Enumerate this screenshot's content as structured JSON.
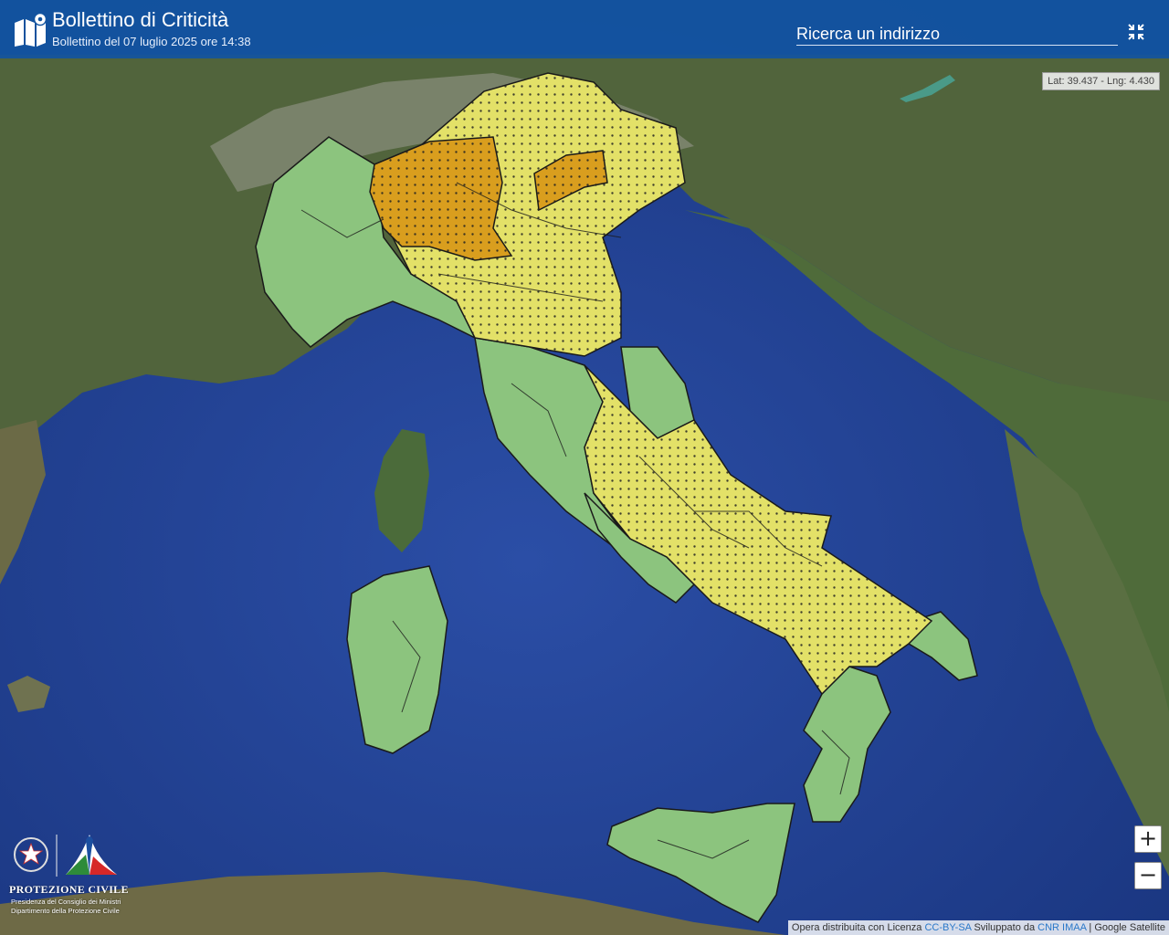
{
  "header": {
    "title": "Bollettino di Criticità",
    "subtitle": "Bollettino del 07 luglio 2025 ore 14:38",
    "icon": "map-pin-icon"
  },
  "search": {
    "placeholder": "Ricerca un indirizzo"
  },
  "toolbar": {
    "fullscreen_icon": "exit-fullscreen-icon"
  },
  "coords": {
    "text": "Lat: 39.437 - Lng: 4.430"
  },
  "zoom": {
    "in_label": "+",
    "out_label": "−"
  },
  "attribution": {
    "prefix": "Opera distribuita con Licenza ",
    "license_link": "CC-BY-SA",
    "middle": " Sviluppato da ",
    "dev_link": "CNR IMAA",
    "suffix": " | Google Satellite"
  },
  "brand": {
    "name": "PROTEZIONE CIVILE",
    "line1": "Presidenza del Consiglio dei Ministri",
    "line2": "Dipartimento della Protezione Civile"
  },
  "legend_colors": {
    "green": "#8cc47e",
    "yellow": "#e3e168",
    "orange": "#d99e1e"
  }
}
